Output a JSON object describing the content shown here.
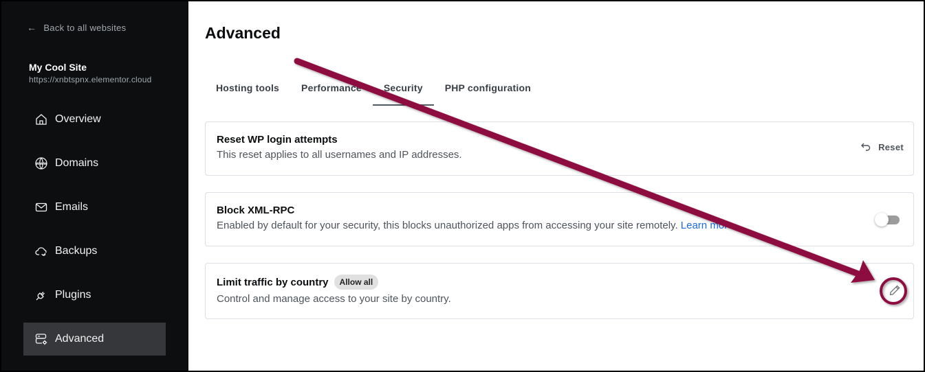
{
  "sidebar": {
    "back_label": "Back to all websites",
    "site_name": "My Cool Site",
    "site_url": "https://xnbtspnx.elementor.cloud",
    "items": [
      {
        "label": "Overview",
        "icon": "home-icon",
        "active": false
      },
      {
        "label": "Domains",
        "icon": "www-globe-icon",
        "active": false
      },
      {
        "label": "Emails",
        "icon": "mail-icon",
        "active": false
      },
      {
        "label": "Backups",
        "icon": "cloud-sync-icon",
        "active": false
      },
      {
        "label": "Plugins",
        "icon": "plug-icon",
        "active": false
      },
      {
        "label": "Advanced",
        "icon": "server-settings-icon",
        "active": true
      }
    ]
  },
  "main": {
    "title": "Advanced",
    "tabs": [
      {
        "label": "Hosting tools",
        "active": false
      },
      {
        "label": "Performance",
        "active": false
      },
      {
        "label": "Security",
        "active": true
      },
      {
        "label": "PHP configuration",
        "active": false
      }
    ],
    "cards": {
      "reset": {
        "title": "Reset WP login attempts",
        "description": "This reset applies to all usernames and IP addresses.",
        "button_label": "Reset",
        "button_icon": "undo-icon"
      },
      "xmlrpc": {
        "title": "Block XML-RPC",
        "description": "Enabled by default for your security, this blocks unauthorized apps from accessing your site remotely.",
        "link_label": "Learn more",
        "toggle_on": false
      },
      "country": {
        "title": "Limit traffic by country",
        "badge": "Allow all",
        "description": "Control and manage access to your site by country.",
        "button_icon": "pencil-icon"
      }
    }
  },
  "annotation": {
    "color": "#8e0b3f",
    "type": "arrow-to-circle",
    "target": "edit-country-button"
  }
}
